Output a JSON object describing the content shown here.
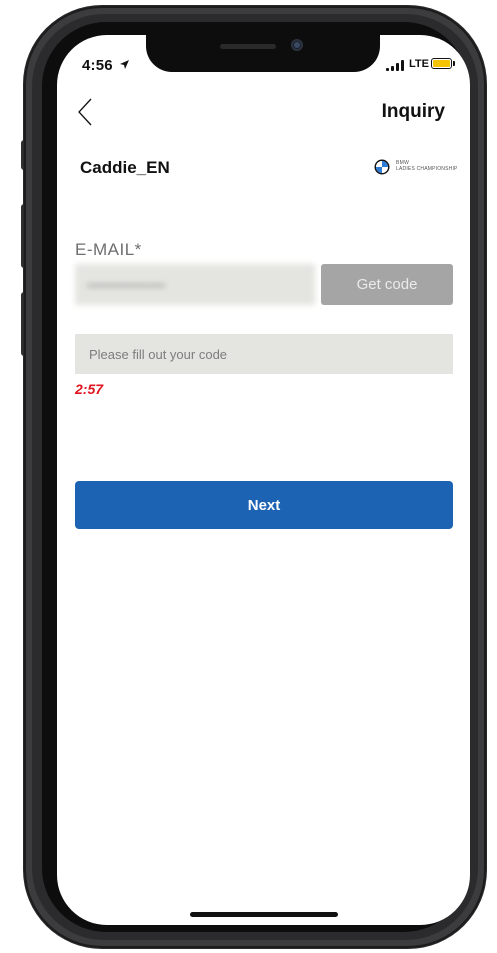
{
  "status_bar": {
    "time": "4:56",
    "network": "LTE",
    "battery_color": "#f5c400"
  },
  "nav": {
    "back_icon": "chevron-left-icon",
    "title": "Inquiry"
  },
  "header": {
    "app_title": "Caddie_EN",
    "brand_line1": "BMW",
    "brand_line2": "LADIES CHAMPIONSHIP"
  },
  "form": {
    "email_label": "E-MAIL*",
    "email_value": "••••••••••••••••",
    "get_code_label": "Get code",
    "code_placeholder": "Please fill out your code",
    "timer": "2:57",
    "next_label": "Next"
  },
  "colors": {
    "primary": "#1d63b4",
    "disabled_button": "#a5a5a5",
    "input_bg": "#e4e5e0",
    "timer": "#e0141e"
  }
}
